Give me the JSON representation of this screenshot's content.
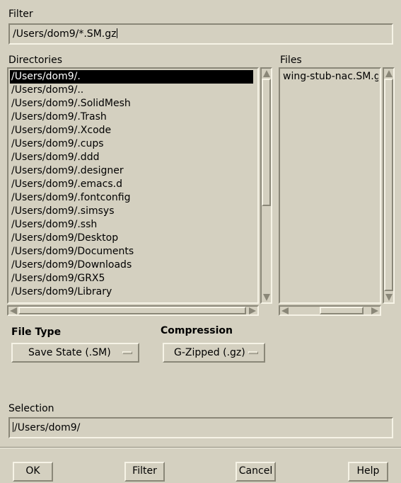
{
  "filter": {
    "label": "Filter",
    "value": "/Users/dom9/*.SM.gz"
  },
  "directories": {
    "label": "Directories",
    "items": [
      "/Users/dom9/.",
      "/Users/dom9/..",
      "/Users/dom9/.SolidMesh",
      "/Users/dom9/.Trash",
      "/Users/dom9/.Xcode",
      "/Users/dom9/.cups",
      "/Users/dom9/.ddd",
      "/Users/dom9/.designer",
      "/Users/dom9/.emacs.d",
      "/Users/dom9/.fontconfig",
      "/Users/dom9/.simsys",
      "/Users/dom9/.ssh",
      "/Users/dom9/Desktop",
      "/Users/dom9/Documents",
      "/Users/dom9/Downloads",
      "/Users/dom9/GRX5",
      "/Users/dom9/Library"
    ],
    "selected_index": 0
  },
  "files": {
    "label": "Files",
    "items": [
      "wing-stub-nac.SM.gz"
    ]
  },
  "file_type": {
    "label": "File Type",
    "value": "Save State (.SM)"
  },
  "compression": {
    "label": "Compression",
    "value": "G-Zipped (.gz)"
  },
  "selection": {
    "label": "Selection",
    "value": "/Users/dom9/"
  },
  "buttons": {
    "ok": "OK",
    "filter": "Filter",
    "cancel": "Cancel",
    "help": "Help"
  },
  "colors": {
    "background": "#d4d0c0",
    "selected_bg": "#000000",
    "selected_fg": "#ffffff"
  }
}
